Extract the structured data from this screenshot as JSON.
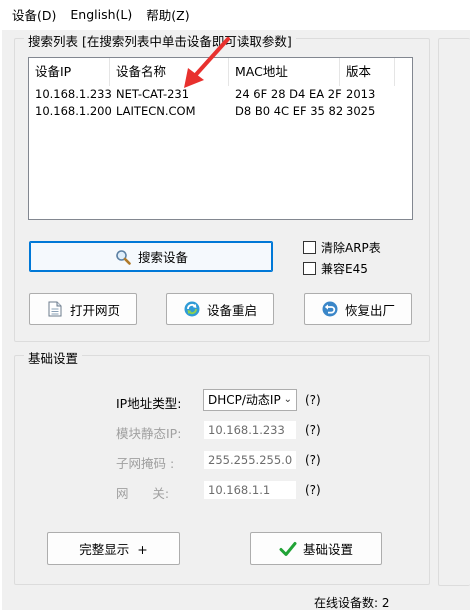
{
  "menu": {
    "items": [
      {
        "label": "设备(D)"
      },
      {
        "label": "English(L)"
      },
      {
        "label": "帮助(Z)"
      }
    ]
  },
  "search_group": {
    "title": "搜索列表 [在搜索列表中单击设备即可读取参数]",
    "columns": [
      "设备IP",
      "设备名称",
      "MAC地址",
      "版本"
    ],
    "rows": [
      {
        "ip": "10.168.1.233",
        "name": "NET-CAT-231",
        "mac": "24 6F 28 D4 EA 2F",
        "version": "2013"
      },
      {
        "ip": "10.168.1.200",
        "name": "LAITECN.COM",
        "mac": "D8 B0 4C EF 35 82",
        "version": "3025"
      }
    ],
    "search_button": "搜索设备",
    "clear_arp_label": "清除ARP表",
    "compat_label": "兼容E45",
    "open_web_button": "打开网页",
    "restart_button": "设备重启",
    "factory_reset_button": "恢复出厂"
  },
  "basic_group": {
    "title": "基础设置",
    "ip_type_label": "IP地址类型:",
    "ip_type_value": "DHCP/动态IP",
    "static_ip_label": "模块静态IP:",
    "static_ip_value": "10.168.1.233",
    "subnet_label": "子网掩码  :",
    "subnet_value": "255.255.255.0",
    "gateway_label": "网      关:",
    "gateway_value": "10.168.1.1",
    "help_mark": "(?)",
    "full_display_button": "完整显示  +",
    "basic_settings_button": "基础设置"
  },
  "status": {
    "online_count": "在线设备数: 2"
  },
  "colors": {
    "accent": "#0078d7",
    "arrow_red": "#e8312e",
    "check_green": "#21a336"
  }
}
